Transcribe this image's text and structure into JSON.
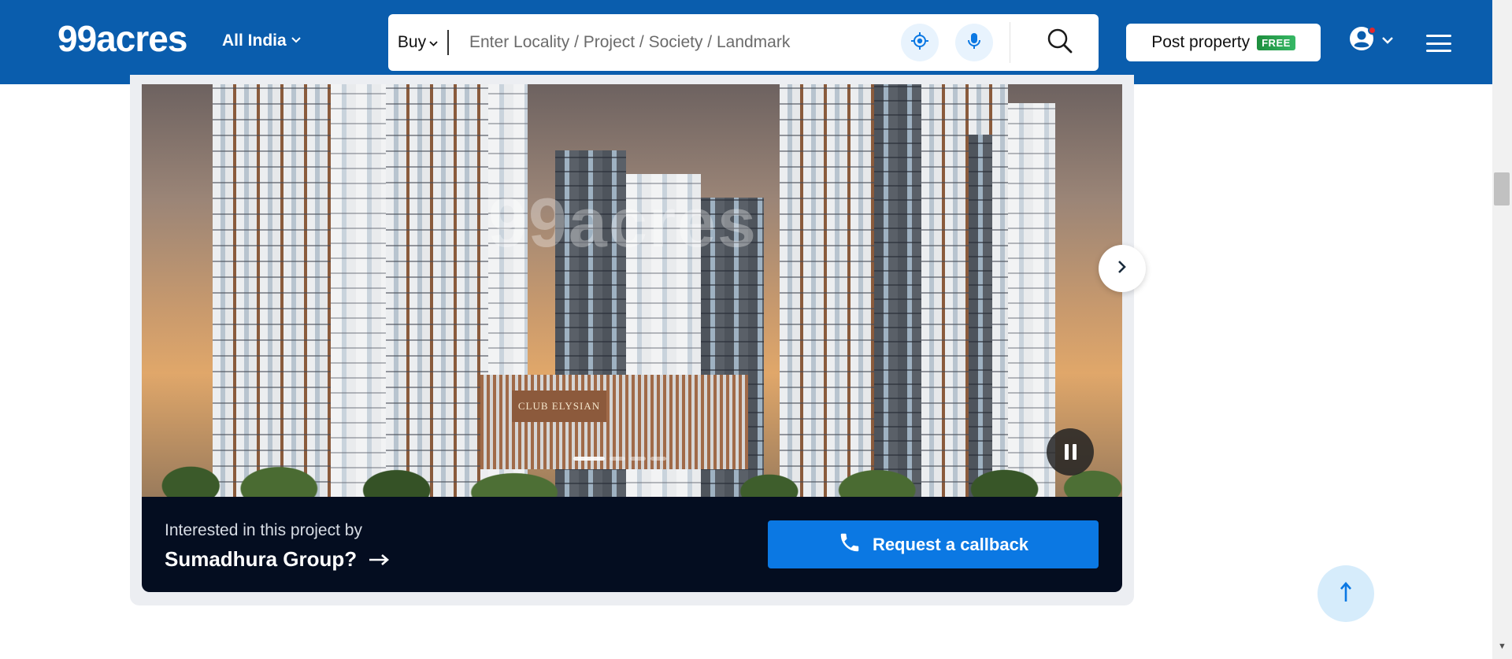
{
  "header": {
    "logo": "99acres",
    "region": "All India",
    "search": {
      "mode": "Buy",
      "placeholder": "Enter Locality / Project / Society / Landmark",
      "value": ""
    },
    "post_property": {
      "label": "Post property",
      "badge": "FREE"
    },
    "has_notification": true
  },
  "gallery": {
    "watermark": "99acres",
    "sign_text": "CLUB ELYSIAN",
    "slide_count": 4,
    "active_slide": 1
  },
  "callback_banner": {
    "interest_text": "Interested in this project by",
    "builder_name": "Sumadhura Group?",
    "button_label": "Request a callback"
  },
  "colors": {
    "brand_blue": "#0a5dad",
    "cta_blue": "#0b78e3",
    "banner_bg": "#040d20",
    "free_badge": "#1e8e3e"
  },
  "icons": {
    "location": "location-crosshair-icon",
    "mic": "microphone-icon",
    "search": "search-icon",
    "user": "user-account-icon",
    "menu": "hamburger-icon",
    "phone": "phone-icon",
    "arrow": "arrow-right-icon",
    "pause": "pause-icon",
    "next": "chevron-right-icon",
    "back_to_top": "arrow-up-icon"
  }
}
